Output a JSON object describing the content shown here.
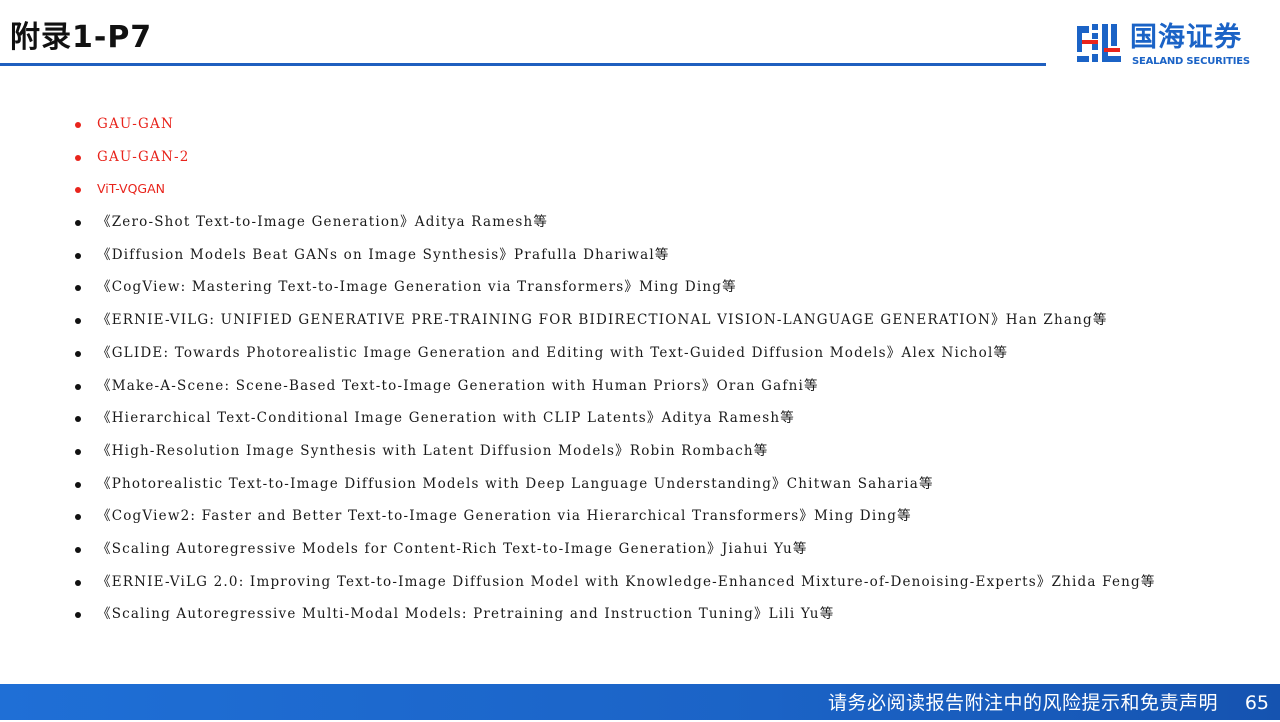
{
  "header": {
    "title": "附录1-P7"
  },
  "logo": {
    "name_cn": "国海证券",
    "name_en": "SEALAND SECURITIES",
    "icon": "sealand-logo-icon"
  },
  "references": [
    {
      "text": "GAU-GAN",
      "highlight": true
    },
    {
      "text": "GAU-GAN-2",
      "highlight": true
    },
    {
      "text": "ViT-VQGAN",
      "highlight": true
    },
    {
      "text": "《Zero-Shot Text-to-Image Generation》Aditya Ramesh等",
      "highlight": false
    },
    {
      "text": "《Diffusion Models Beat GANs on Image Synthesis》Prafulla Dhariwal等",
      "highlight": false
    },
    {
      "text": "《CogView: Mastering Text-to-Image Generation via Transformers》Ming Ding等",
      "highlight": false
    },
    {
      "text": "《ERNIE-VILG: UNIFIED GENERATIVE PRE-TRAINING FOR BIDIRECTIONAL VISION-LANGUAGE GENERATION》Han Zhang等",
      "highlight": false
    },
    {
      "text": "《GLIDE: Towards Photorealistic Image Generation and Editing with Text-Guided Diffusion Models》Alex Nichol等",
      "highlight": false
    },
    {
      "text": "《Make-A-Scene: Scene-Based Text-to-Image Generation with Human Priors》Oran Gafni等",
      "highlight": false
    },
    {
      "text": "《Hierarchical Text-Conditional Image Generation with CLIP Latents》Aditya Ramesh等",
      "highlight": false
    },
    {
      "text": "《High-Resolution Image Synthesis with Latent Diffusion Models》Robin Rombach等",
      "highlight": false
    },
    {
      "text": "《Photorealistic Text-to-Image Diffusion Models with Deep Language Understanding》Chitwan Saharia等",
      "highlight": false
    },
    {
      "text": "《CogView2: Faster and Better Text-to-Image Generation via Hierarchical Transformers》Ming Ding等",
      "highlight": false
    },
    {
      "text": "《Scaling Autoregressive Models for Content-Rich Text-to-Image Generation》Jiahui Yu等",
      "highlight": false
    },
    {
      "text": "《ERNIE-ViLG 2.0: Improving Text-to-Image Diffusion Model with Knowledge-Enhanced Mixture-of-Denoising-Experts》Zhida Feng等",
      "highlight": false
    },
    {
      "text": "《Scaling Autoregressive Multi-Modal Models: Pretraining and Instruction Tuning》Lili Yu等",
      "highlight": false
    }
  ],
  "footer": {
    "disclaimer": "请务必阅读报告附注中的风险提示和免责声明",
    "page_number": "65"
  },
  "colors": {
    "accent_blue": "#1b63c6",
    "highlight_red": "#e8241c",
    "text": "#1a1a1a"
  }
}
